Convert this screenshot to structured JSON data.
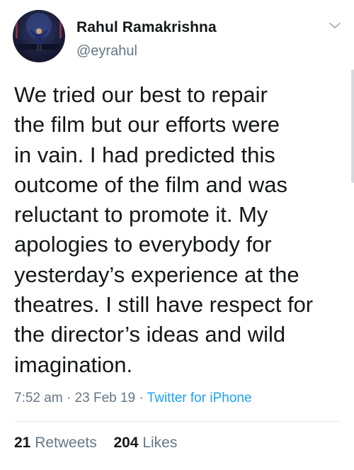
{
  "user": {
    "display_name": "Rahul Ramakrishna",
    "handle": "@eyrahul"
  },
  "tweet": {
    "text": "We tried our best to repair\nthe film but our efforts were\nin vain. I had predicted this\noutcome of the film and was\nreluctant to promote it. My\napologies to everybody for\nyesterday’s experience at the\ntheatres. I still have respect for\nthe director’s ideas and wild\nimagination.",
    "time": "7:52 am",
    "separator": "·",
    "date": "23 Feb 19",
    "source": "Twitter for iPhone"
  },
  "stats": {
    "retweets_count": "21",
    "retweets_label": "Retweets",
    "likes_count": "204",
    "likes_label": "Likes"
  },
  "icons": {
    "more": "chevron-down-icon"
  },
  "colors": {
    "text": "#14171a",
    "secondary": "#657786",
    "link": "#1da1f2",
    "divider": "#e1e8ed"
  }
}
